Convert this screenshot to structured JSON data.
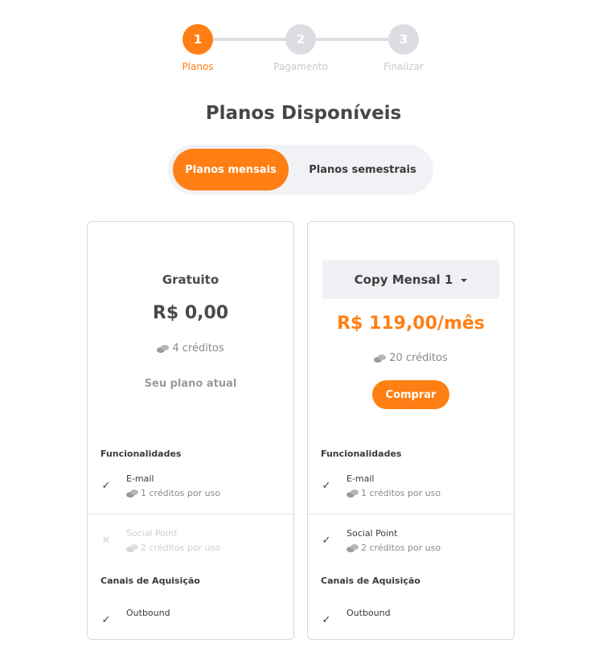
{
  "stepper": {
    "steps": [
      {
        "number": "1",
        "label": "Planos"
      },
      {
        "number": "2",
        "label": "Pagamento"
      },
      {
        "number": "3",
        "label": "Finalizar"
      }
    ],
    "active_step": 1
  },
  "page_title": "Planos Disponíveis",
  "billing_toggle": {
    "monthly_label": "Planos mensais",
    "semester_label": "Planos semestrais",
    "selected": "Planos mensais"
  },
  "plans": [
    {
      "name": "Gratuito",
      "price": "R$ 0,00",
      "credits": "4 créditos",
      "current_label": "Seu plano atual",
      "features_title": "Funcionalidades",
      "features": [
        {
          "name": "E-mail",
          "cost": "1 créditos por uso",
          "enabled": true
        },
        {
          "name": "Social Point",
          "cost": "2 créditos por uso",
          "enabled": false
        }
      ],
      "channels_title": "Canais de Aquisição",
      "channels": [
        {
          "name": "Outbound",
          "enabled": true
        }
      ]
    },
    {
      "selected_plan": "Copy Mensal 1",
      "price": "R$ 119,00/mês",
      "credits": "20 créditos",
      "buy_label": "Comprar",
      "features_title": "Funcionalidades",
      "features": [
        {
          "name": "E-mail",
          "cost": "1 créditos por uso",
          "enabled": true
        },
        {
          "name": "Social Point",
          "cost": "2 créditos por uso",
          "enabled": true
        }
      ],
      "channels_title": "Canais de Aquisição",
      "channels": [
        {
          "name": "Outbound",
          "enabled": true
        }
      ]
    }
  ],
  "icons": {
    "check": "check-icon",
    "cross": "close-icon",
    "coins": "coins-icon",
    "caret": "chevron-down-icon"
  },
  "colors": {
    "accent": "#ff7f14",
    "inactive": "#dcdde3",
    "text": "#4a4a4a",
    "muted": "#8a8a8a",
    "disabled": "#cfcfd4"
  }
}
